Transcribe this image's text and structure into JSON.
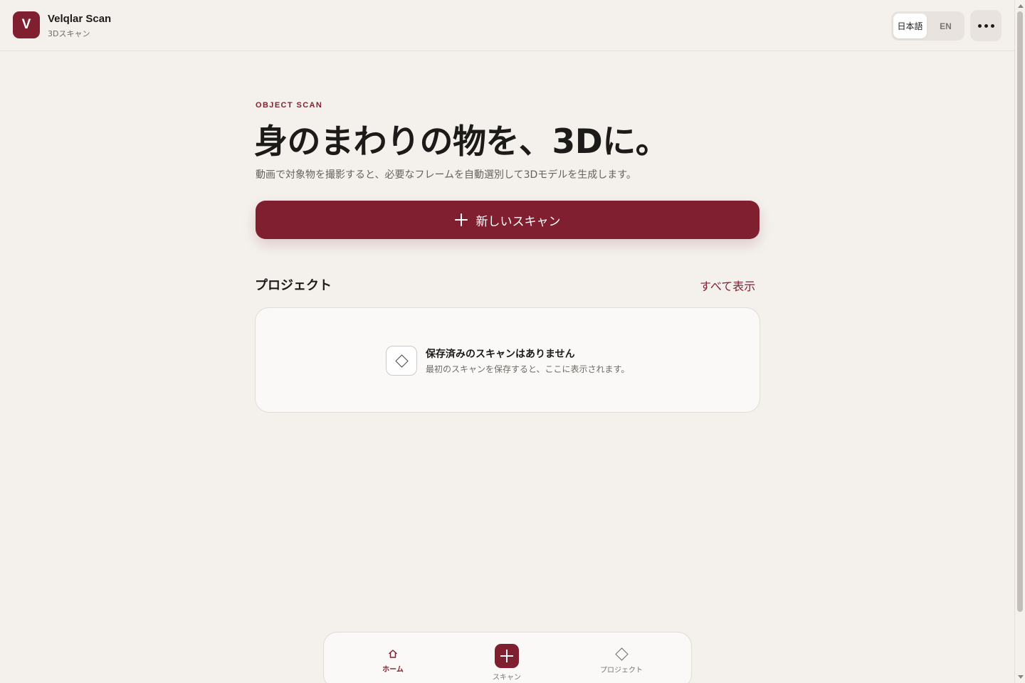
{
  "header": {
    "logo_letter": "V",
    "app_name": "Velqlar Scan",
    "app_subtitle": "3Dスキャン",
    "languages": [
      {
        "label": "日本語",
        "active": true
      },
      {
        "label": "EN",
        "active": false
      }
    ],
    "more_icon": "more-horizontal-icon"
  },
  "hero": {
    "eyebrow": "OBJECT SCAN",
    "headline": "身のまわりの物を、3Dに。",
    "description": "動画で対象物を撮影すると、必要なフレームを自動選別して3Dモデルを生成します。",
    "primary_button": "新しいスキャン"
  },
  "projects": {
    "title": "プロジェクト",
    "see_all": "すべて表示",
    "empty_title": "保存済みのスキャンはありません",
    "empty_description": "最初のスキャンを保存すると、ここに表示されます。"
  },
  "bottom_nav": {
    "items": [
      {
        "label": "ホーム",
        "icon": "home-icon",
        "active": true
      },
      {
        "label": "スキャン",
        "icon": "plus-icon",
        "active": false
      },
      {
        "label": "プロジェクト",
        "icon": "diamond-icon",
        "active": false
      }
    ]
  },
  "colors": {
    "accent": "#7f1f2f",
    "background": "#f4f1ed",
    "card": "#faf9f7"
  }
}
